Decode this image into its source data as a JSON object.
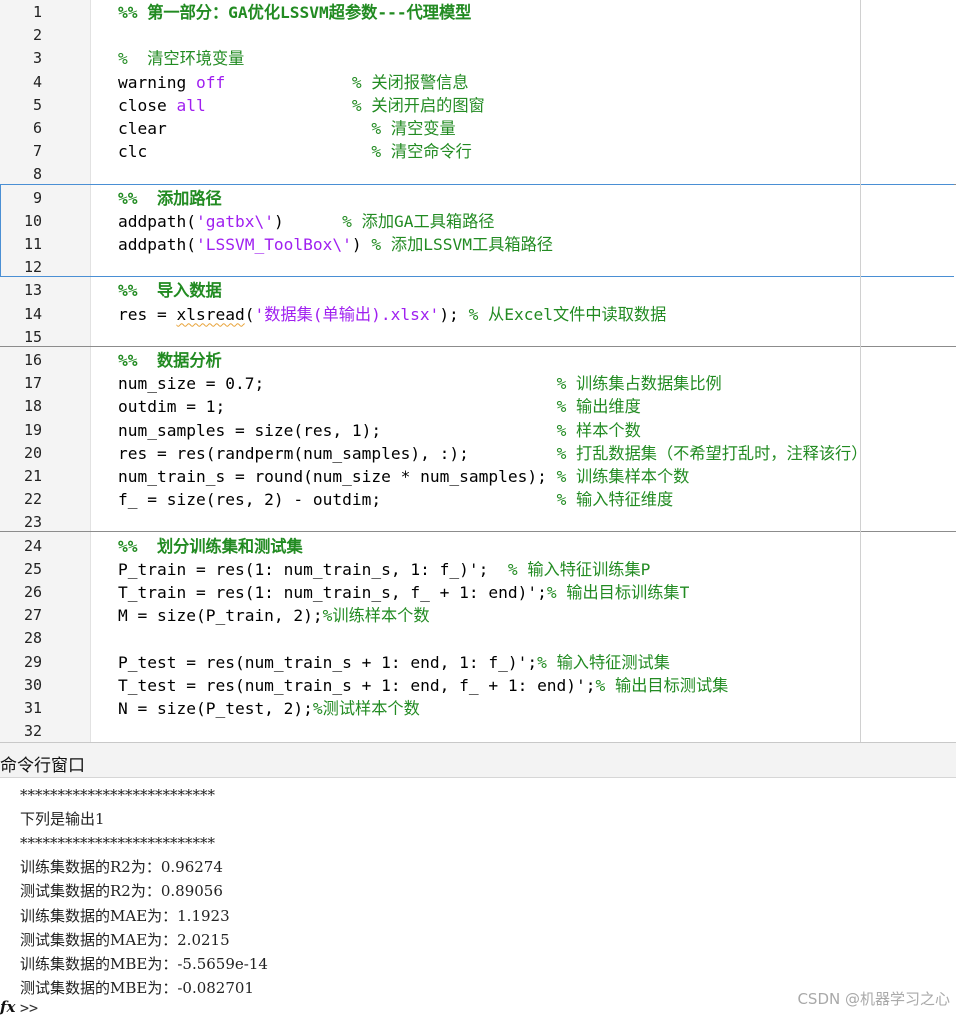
{
  "editor": {
    "lines": [
      {
        "n": "1",
        "tokens": [
          {
            "t": "%% 第一部分：GA优化LSSVM超参数---代理模型",
            "c": "cellhead"
          }
        ]
      },
      {
        "n": "2",
        "tokens": []
      },
      {
        "n": "3",
        "tokens": [
          {
            "t": "%  清空环境变量",
            "c": "comment"
          }
        ]
      },
      {
        "n": "4",
        "tokens": [
          {
            "t": "warning ",
            "c": "plain"
          },
          {
            "t": "off",
            "c": "keyword"
          },
          {
            "t": "             ",
            "c": "plain"
          },
          {
            "t": "% 关闭报警信息",
            "c": "comment"
          }
        ]
      },
      {
        "n": "5",
        "tokens": [
          {
            "t": "close ",
            "c": "plain"
          },
          {
            "t": "all",
            "c": "keyword"
          },
          {
            "t": "               ",
            "c": "plain"
          },
          {
            "t": "% 关闭开启的图窗",
            "c": "comment"
          }
        ]
      },
      {
        "n": "6",
        "tokens": [
          {
            "t": "clear                     ",
            "c": "plain"
          },
          {
            "t": "% 清空变量",
            "c": "comment"
          }
        ]
      },
      {
        "n": "7",
        "tokens": [
          {
            "t": "clc                       ",
            "c": "plain"
          },
          {
            "t": "% 清空命令行",
            "c": "comment"
          }
        ]
      },
      {
        "n": "8",
        "tokens": []
      },
      {
        "n": "9",
        "tokens": [
          {
            "t": "%%  添加路径",
            "c": "cellhead"
          }
        ]
      },
      {
        "n": "10",
        "tokens": [
          {
            "t": "addpath(",
            "c": "plain"
          },
          {
            "t": "'gatbx\\'",
            "c": "string"
          },
          {
            "t": ")      ",
            "c": "plain"
          },
          {
            "t": "% 添加GA工具箱路径",
            "c": "comment"
          }
        ]
      },
      {
        "n": "11",
        "tokens": [
          {
            "t": "addpath(",
            "c": "plain"
          },
          {
            "t": "'LSSVM_ToolBox\\'",
            "c": "string"
          },
          {
            "t": ") ",
            "c": "plain"
          },
          {
            "t": "% 添加LSSVM工具箱路径",
            "c": "comment"
          }
        ]
      },
      {
        "n": "12",
        "tokens": []
      },
      {
        "n": "13",
        "tokens": [
          {
            "t": "%%  导入数据",
            "c": "cellhead"
          }
        ]
      },
      {
        "n": "14",
        "tokens": [
          {
            "t": "res = ",
            "c": "plain"
          },
          {
            "t": "xlsread",
            "c": "squiggle"
          },
          {
            "t": "(",
            "c": "plain"
          },
          {
            "t": "'数据集(单输出).xlsx'",
            "c": "string"
          },
          {
            "t": "); ",
            "c": "plain"
          },
          {
            "t": "% 从Excel文件中读取数据",
            "c": "comment"
          }
        ]
      },
      {
        "n": "15",
        "tokens": []
      },
      {
        "n": "16",
        "tokens": [
          {
            "t": "%%  数据分析",
            "c": "cellhead"
          }
        ]
      },
      {
        "n": "17",
        "tokens": [
          {
            "t": "num_size = 0.7;                              ",
            "c": "plain"
          },
          {
            "t": "% 训练集占数据集比例",
            "c": "comment"
          }
        ]
      },
      {
        "n": "18",
        "tokens": [
          {
            "t": "outdim = 1;                                  ",
            "c": "plain"
          },
          {
            "t": "% 输出维度",
            "c": "comment"
          }
        ]
      },
      {
        "n": "19",
        "tokens": [
          {
            "t": "num_samples = size(res, 1);                  ",
            "c": "plain"
          },
          {
            "t": "% 样本个数",
            "c": "comment"
          }
        ]
      },
      {
        "n": "20",
        "tokens": [
          {
            "t": "res = res(randperm(num_samples), :);         ",
            "c": "plain"
          },
          {
            "t": "% 打乱数据集（不希望打乱时，注释该行）",
            "c": "comment"
          }
        ]
      },
      {
        "n": "21",
        "tokens": [
          {
            "t": "num_train_s = round(num_size * num_samples); ",
            "c": "plain"
          },
          {
            "t": "% 训练集样本个数",
            "c": "comment"
          }
        ]
      },
      {
        "n": "22",
        "tokens": [
          {
            "t": "f_ = size(res, 2) - outdim;                  ",
            "c": "plain"
          },
          {
            "t": "% 输入特征维度",
            "c": "comment"
          }
        ]
      },
      {
        "n": "23",
        "tokens": []
      },
      {
        "n": "24",
        "tokens": [
          {
            "t": "%%  划分训练集和测试集",
            "c": "cellhead"
          }
        ]
      },
      {
        "n": "25",
        "tokens": [
          {
            "t": "P_train = res(1: num_train_s, 1: f_)';  ",
            "c": "plain"
          },
          {
            "t": "% 输入特征训练集P",
            "c": "comment"
          }
        ]
      },
      {
        "n": "26",
        "tokens": [
          {
            "t": "T_train = res(1: num_train_s, f_ + 1: end)';",
            "c": "plain"
          },
          {
            "t": "% 输出目标训练集T",
            "c": "comment"
          }
        ]
      },
      {
        "n": "27",
        "tokens": [
          {
            "t": "M = size(P_train, 2);",
            "c": "plain"
          },
          {
            "t": "%训练样本个数",
            "c": "comment"
          }
        ]
      },
      {
        "n": "28",
        "tokens": []
      },
      {
        "n": "29",
        "tokens": [
          {
            "t": "P_test = res(num_train_s + 1: end, 1: f_)';",
            "c": "plain"
          },
          {
            "t": "% 输入特征测试集",
            "c": "comment"
          }
        ]
      },
      {
        "n": "30",
        "tokens": [
          {
            "t": "T_test = res(num_train_s + 1: end, f_ + 1: end)';",
            "c": "plain"
          },
          {
            "t": "% 输出目标测试集",
            "c": "comment"
          }
        ]
      },
      {
        "n": "31",
        "tokens": [
          {
            "t": "N = size(P_test, 2);",
            "c": "plain"
          },
          {
            "t": "%测试样本个数",
            "c": "comment"
          }
        ]
      },
      {
        "n": "32",
        "tokens": []
      }
    ],
    "colors": {
      "comment": "#228b22",
      "keyword": "#a020f0",
      "string": "#a020f0",
      "active_cell_border": "#4a8fd4"
    }
  },
  "command_window": {
    "title": "命令行窗口",
    "output": [
      "**************************",
      "下列是输出1",
      "**************************",
      "训练集数据的R2为：0.96274",
      "测试集数据的R2为：0.89056",
      "训练集数据的MAE为：1.1923",
      "测试集数据的MAE为：2.0215",
      "训练集数据的MBE为：-5.5659e-14",
      "测试集数据的MBE为：-0.082701"
    ],
    "fx_icon": "fx",
    "prompt": ">>"
  },
  "watermark": "CSDN @机器学习之心"
}
